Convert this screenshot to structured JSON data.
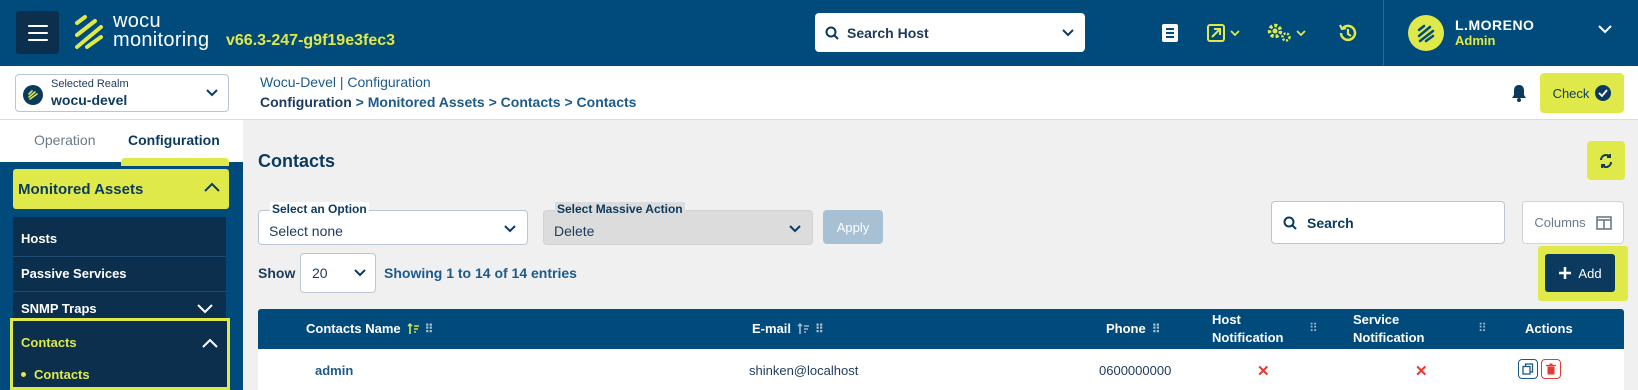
{
  "header": {
    "logo_line1": "wocu",
    "logo_line2": "monitoring",
    "version": "v66.3-247-g9f19e3fec3",
    "search_placeholder": "Search Host",
    "user_name": "L.MORENO",
    "user_role": "Admin"
  },
  "realm": {
    "label": "Selected Realm",
    "value": "wocu-devel"
  },
  "breadcrumb": {
    "top": "Wocu-Devel | Configuration",
    "trail": [
      "Configuration",
      "Monitored Assets",
      "Contacts",
      "Contacts"
    ],
    "separator": ">"
  },
  "check_button": "Check",
  "sidebar": {
    "tabs": [
      "Operation",
      "Configuration"
    ],
    "active_tab": "Configuration",
    "group": "Monitored Assets",
    "items": [
      "Hosts",
      "Passive Services",
      "SNMP Traps"
    ],
    "contacts_group": "Contacts",
    "contacts_sub": "Contacts"
  },
  "main": {
    "title": "Contacts",
    "option_select": {
      "label": "Select an Option",
      "value": "Select none"
    },
    "massive_select": {
      "label": "Select Massive Action",
      "value": "Delete"
    },
    "apply_label": "Apply",
    "search_placeholder": "Search",
    "columns_label": "Columns",
    "show_label": "Show",
    "page_size": "20",
    "showing_text": "Showing 1 to 14 of 14 entries",
    "add_label": "Add"
  },
  "table": {
    "columns": {
      "name": "Contacts Name",
      "email": "E-mail",
      "phone": "Phone",
      "host_notification_1": "Host",
      "host_notification_2": "Notification",
      "service_notification_1": "Service",
      "service_notification_2": "Notification",
      "actions": "Actions"
    },
    "rows": [
      {
        "name": "admin",
        "email": "shinken@localhost",
        "phone": "0600000000",
        "host_notification": "✕",
        "service_notification": "✕"
      }
    ]
  },
  "colors": {
    "primary": "#004b7c",
    "dark": "#0b2f4c",
    "accent": "#dfe94a",
    "danger": "#e53935"
  }
}
